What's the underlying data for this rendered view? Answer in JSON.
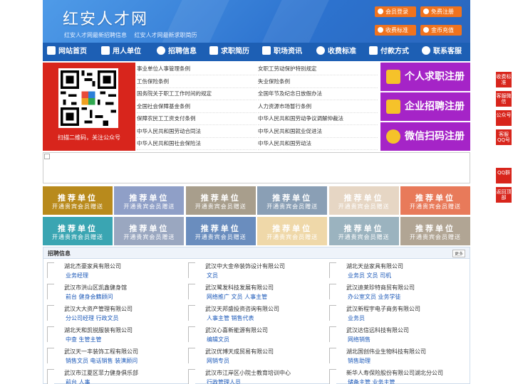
{
  "header": {
    "logo": "红安人才网",
    "taglines": [
      "红安人才网最新招聘信息",
      "红安人才网最新求职简历"
    ],
    "buttons": [
      {
        "label": "会员登录",
        "icon": "user-icon"
      },
      {
        "label": "免费注册",
        "icon": "user-add-icon"
      },
      {
        "label": "收费标准",
        "icon": "tag-icon"
      },
      {
        "label": "金币充值",
        "icon": "coin-icon"
      }
    ]
  },
  "nav": [
    {
      "label": "网站首页",
      "icon": "home-icon"
    },
    {
      "label": "用人单位",
      "icon": "building-icon"
    },
    {
      "label": "招聘信息",
      "icon": "people-icon"
    },
    {
      "label": "求职简历",
      "icon": "resume-icon"
    },
    {
      "label": "职场资讯",
      "icon": "news-icon"
    },
    {
      "label": "收费标准",
      "icon": "fee-icon"
    },
    {
      "label": "付款方式",
      "icon": "payment-icon"
    },
    {
      "label": "联系客服",
      "icon": "phone-icon"
    }
  ],
  "qr_ad": {
    "caption": "扫描二维码，关注公众号"
  },
  "policy_links": [
    "事业单位人事管理条例",
    "女职工劳动保护特别规定",
    "工伤保险条例",
    "失业保险条例",
    "国务院关于职工工作时间的规定",
    "全国年节及纪念日放假办法",
    "全国社会保障基金条例",
    "人力资源市场暂行条例",
    "保障农民工工资支付条例",
    "中华人民共和国劳动争议调解仲裁法",
    "中华人民共和国劳动合同法",
    "中华人民共和国就业促进法",
    "中华人民共和国社会保险法",
    "中华人民共和国劳动法"
  ],
  "register": [
    {
      "label": "个人求职注册",
      "icon": "person-icon"
    },
    {
      "label": "企业招聘注册",
      "icon": "company-icon"
    },
    {
      "label": "微信扫码注册",
      "icon": "wechat-icon"
    }
  ],
  "tiles": {
    "title": "推荐单位",
    "subtitle": "开通贵宾会员赠送",
    "colors": [
      "#b88a1c",
      "#8f9fc7",
      "#a89e8c",
      "#8a9fb5",
      "#e6d6c4",
      "#e87a5a",
      "#3aa5b2",
      "#9aa7c0",
      "#6a8dbe",
      "#efd8a9",
      "#9bb3bf",
      "#b1a594"
    ]
  },
  "jobs": {
    "title": "招聘信息",
    "more": "更多",
    "entries": [
      {
        "company": "湖北杰豪家具有限公司",
        "positions": "业务经理"
      },
      {
        "company": "武汉中大金帝装饰设计有限公司",
        "positions": "文员"
      },
      {
        "company": "湖北天益家具有限公司",
        "positions": "业务员 文员 司机"
      },
      {
        "company": "武汉市洪山区凯鑫健身馆",
        "positions": "前台 健身会籍顾问"
      },
      {
        "company": "武汉鹭发科技发展有限公司",
        "positions": "网络推广 文员 人事主管"
      },
      {
        "company": "武汉迪莱珍特商贸有限公司",
        "positions": "办公室文员 业务学徒"
      },
      {
        "company": "武汉大大资产管理有限公司",
        "positions": "分公司经理 行政文员"
      },
      {
        "company": "武汉天邦盛投资咨询有限公司",
        "positions": "人事主管 销售代表"
      },
      {
        "company": "武汉新程宇电子商务有限公司",
        "positions": "业务员"
      },
      {
        "company": "湖北天和凯锐服装有限公司",
        "positions": "中查 生管主管"
      },
      {
        "company": "武汉心喜新能源有限公司",
        "positions": "编辑文员"
      },
      {
        "company": "武汉达信远科技有限公司",
        "positions": "网络销售"
      },
      {
        "company": "武汉天一丰装饰工程有限公司",
        "positions": "销售文员 电话销售 装潢顾问"
      },
      {
        "company": "武汉优博天成贸易有限公司",
        "positions": "网销专员"
      },
      {
        "company": "湖北国创伟业生物科技有限公司",
        "positions": "销售助理"
      },
      {
        "company": "武汉市江夏区菲力健身俱乐部",
        "positions": "前台 人事"
      },
      {
        "company": "武汉市江岸区小院士教育培训中心",
        "positions": "行政管理人员"
      },
      {
        "company": "新华人寿保险股份有限公司湖北分公司",
        "positions": "储备主管 业务主管"
      }
    ]
  },
  "side_float": [
    "收费标准",
    "客服微信",
    "公众号",
    "客服QQ号",
    "QQ群",
    "返回顶部"
  ]
}
